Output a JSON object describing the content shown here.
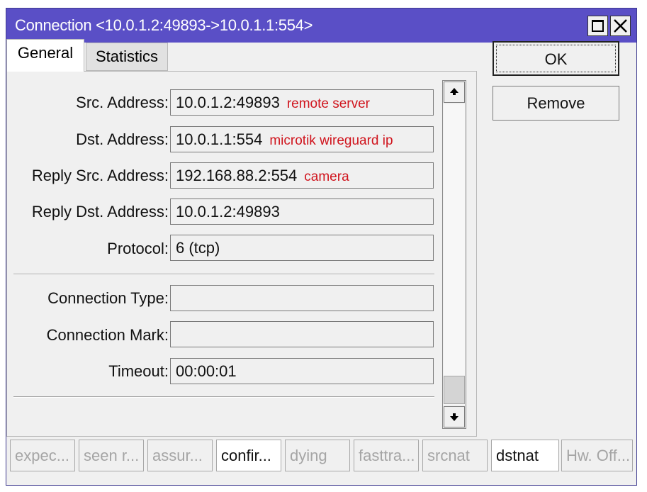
{
  "window": {
    "title": "Connection <10.0.1.2:49893->10.0.1.1:554>",
    "titlebar_color": "#5a4fc6"
  },
  "tabs": [
    {
      "label": "General",
      "active": true
    },
    {
      "label": "Statistics",
      "active": false
    }
  ],
  "fields": {
    "src_address": {
      "label": "Src. Address:",
      "value": "10.0.1.2:49893",
      "note": "remote server"
    },
    "dst_address": {
      "label": "Dst. Address:",
      "value": "10.0.1.1:554",
      "note": "microtik wireguard ip"
    },
    "reply_src_address": {
      "label": "Reply Src. Address:",
      "value": "192.168.88.2:554",
      "note": "camera"
    },
    "reply_dst_address": {
      "label": "Reply Dst. Address:",
      "value": "10.0.1.2:49893"
    },
    "protocol": {
      "label": "Protocol:",
      "value": "6 (tcp)"
    },
    "connection_type": {
      "label": "Connection Type:",
      "value": ""
    },
    "connection_mark": {
      "label": "Connection Mark:",
      "value": ""
    },
    "timeout": {
      "label": "Timeout:",
      "value": "00:00:01"
    }
  },
  "buttons": {
    "ok": "OK",
    "remove": "Remove"
  },
  "status_flags": [
    {
      "label": "expec...",
      "active": false
    },
    {
      "label": "seen r...",
      "active": false
    },
    {
      "label": "assur...",
      "active": false
    },
    {
      "label": "confir...",
      "active": true
    },
    {
      "label": "dying",
      "active": false
    },
    {
      "label": "fasttra...",
      "active": false
    },
    {
      "label": "srcnat",
      "active": false
    },
    {
      "label": "dstnat",
      "active": true
    },
    {
      "label": "Hw. Off...",
      "active": false
    }
  ],
  "colors": {
    "annotation": "#d0141d",
    "inactive_flag": "#a5a5a5"
  }
}
